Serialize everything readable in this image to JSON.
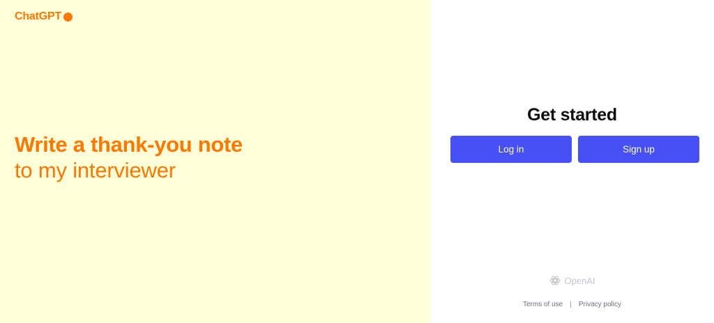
{
  "brand": {
    "name": "ChatGPT"
  },
  "hero": {
    "line1": "Write a thank-you note",
    "line2": "to my interviewer"
  },
  "auth": {
    "heading": "Get started",
    "login_label": "Log in",
    "signup_label": "Sign up"
  },
  "footer": {
    "org_name": "OpenAI",
    "terms_label": "Terms of use",
    "separator": "|",
    "privacy_label": "Privacy policy"
  },
  "colors": {
    "left_bg": "#ffffd9",
    "accent": "#ff7700",
    "button": "#4650f5"
  }
}
